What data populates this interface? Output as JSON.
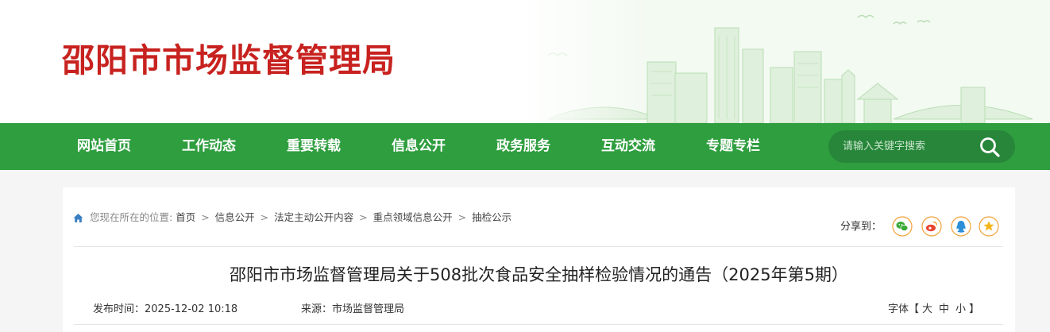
{
  "header": {
    "site_title": "邵阳市市场监督管理局"
  },
  "nav": {
    "items": [
      {
        "label": "网站首页"
      },
      {
        "label": "工作动态"
      },
      {
        "label": "重要转载"
      },
      {
        "label": "信息公开"
      },
      {
        "label": "政务服务"
      },
      {
        "label": "互动交流"
      },
      {
        "label": "专题专栏"
      }
    ],
    "search_placeholder": "请输入关键字搜索"
  },
  "breadcrumb": {
    "lead": "您现在所在的位置:",
    "items": [
      "首页",
      "信息公开",
      "法定主动公开内容",
      "重点领域信息公开",
      "抽检公示"
    ],
    "separator": ">"
  },
  "share": {
    "label": "分享到：",
    "icons": [
      "wechat-icon",
      "weibo-icon",
      "qq-icon",
      "qzone-icon"
    ]
  },
  "article": {
    "title": "邵阳市市场监督管理局关于508批次食品安全抽样检验情况的通告（2025年第5期）",
    "publish_label": "发布时间：",
    "publish_time": "2025-12-02 10:18",
    "source_label": "来源：",
    "source": "市场监督管理局",
    "font_label": "字体【",
    "font_large": "大",
    "font_medium": "中",
    "font_small": "小",
    "font_close": "】"
  },
  "colors": {
    "brand_red": "#c7221f",
    "nav_green": "#2f9e3f",
    "search_bg": "#27863a"
  }
}
